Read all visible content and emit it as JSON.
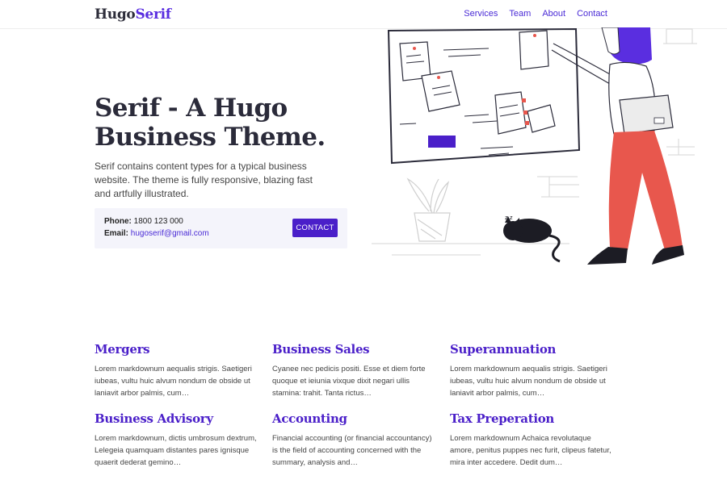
{
  "header": {
    "logo_part1": "Hugo",
    "logo_part2": "Serif",
    "nav": [
      "Services",
      "Team",
      "About",
      "Contact"
    ]
  },
  "hero": {
    "title_line1": "Serif - A Hugo",
    "title_line2": "Business Theme.",
    "description": "Serif contains content types for a typical business website. The theme is fully responsive, blazing fast and artfully illustrated.",
    "phone_label": "Phone:",
    "phone": "1800 123 000",
    "email_label": "Email:",
    "email": "hugoserif@gmail.com",
    "contact_button": "CONTACT"
  },
  "services": [
    {
      "title": "Mergers",
      "desc": "Lorem markdownum aequalis strigis. Saetigeri iubeas, vultu huic alvum nondum de obside ut laniavit arbor palmis, cum…"
    },
    {
      "title": "Business Sales",
      "desc": "Cyanee nec pedicis positi. Esse et diem forte quoque et ieiunia vixque dixit negari ullis stamina: trahit. Tanta rictus…"
    },
    {
      "title": "Superannuation",
      "desc": "Lorem markdownum aequalis strigis. Saetigeri iubeas, vultu huic alvum nondum de obside ut laniavit arbor palmis, cum…"
    },
    {
      "title": "Business Advisory",
      "desc": "Lorem markdownum, dictis umbrosum dextrum, Lelegeia quamquam distantes pares ignisque quaerit dederat gemino…"
    },
    {
      "title": "Accounting",
      "desc": "Financial accounting (or financial accountancy) is the field of accounting concerned with the summary, analysis and…"
    },
    {
      "title": "Tax Preperation",
      "desc": "Lorem markdownum Achaica revolutaque amore, penitus puppes nec furit, clipeus fatetur, mira inter accedere. Dedit dum…"
    }
  ],
  "colors": {
    "accent": "#4a1fc9",
    "pants": "#e8574d",
    "hair": "#5a2ee0"
  }
}
